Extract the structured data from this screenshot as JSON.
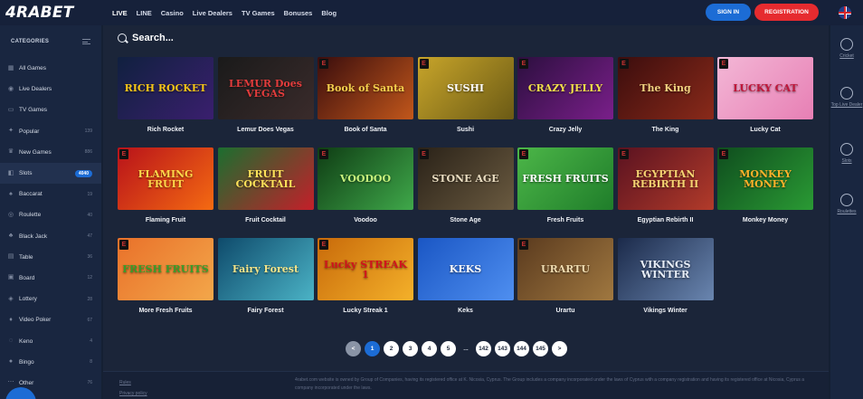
{
  "brand": {
    "logo": "4RABET"
  },
  "nav": [
    "LIVE",
    "LINE",
    "Casino",
    "Live Dealers",
    "TV Games",
    "Bonuses",
    "Blog"
  ],
  "auth": {
    "signin": "SIGN IN",
    "register": "REGISTRATION"
  },
  "colors": {
    "primary": "#1c6cd5",
    "danger": "#e62b2f",
    "bg": "#1b2539",
    "sidebar": "#192640"
  },
  "sidebar": {
    "heading": "CATEGORIES",
    "items": [
      {
        "label": "All Games",
        "count": "",
        "icon": "grid-icon"
      },
      {
        "label": "Live Dealers",
        "count": "",
        "icon": "dealer-icon"
      },
      {
        "label": "TV Games",
        "count": "",
        "icon": "tv-icon"
      },
      {
        "label": "Popular",
        "count": "139",
        "icon": "flame-icon"
      },
      {
        "label": "New Games",
        "count": "886",
        "icon": "crown-icon"
      },
      {
        "label": "Slots",
        "count": "4040",
        "icon": "slot-icon"
      },
      {
        "label": "Baccarat",
        "count": "19",
        "icon": "cards-icon"
      },
      {
        "label": "Roulette",
        "count": "40",
        "icon": "roulette-icon"
      },
      {
        "label": "Black Jack",
        "count": "47",
        "icon": "blackjack-icon"
      },
      {
        "label": "Table",
        "count": "36",
        "icon": "table-icon"
      },
      {
        "label": "Board",
        "count": "12",
        "icon": "board-icon"
      },
      {
        "label": "Lottery",
        "count": "28",
        "icon": "lottery-icon"
      },
      {
        "label": "Video Poker",
        "count": "67",
        "icon": "poker-icon"
      },
      {
        "label": "Keno",
        "count": "4",
        "icon": "keno-icon"
      },
      {
        "label": "Bingo",
        "count": "8",
        "icon": "bingo-icon"
      },
      {
        "label": "Other",
        "count": "76",
        "icon": "other-icon"
      }
    ]
  },
  "search": {
    "label": "Search..."
  },
  "games": [
    {
      "name": "Rich Rocket",
      "art": "RICH ROCKET",
      "bg": "linear-gradient(135deg,#10203f,#3a1f6e)",
      "fg": "#f5c518",
      "e": false
    },
    {
      "name": "Lemur Does Vegas",
      "art": "LEMUR Does VEGAS",
      "bg": "linear-gradient(135deg,#1a1a1a,#3a2b2b)",
      "fg": "#e23c3c",
      "e": false
    },
    {
      "name": "Book of Santa",
      "art": "Book of Santa",
      "bg": "linear-gradient(135deg,#3a0d0d,#c2571b)",
      "fg": "#f6d04d",
      "e": true
    },
    {
      "name": "Sushi",
      "art": "SUSHI",
      "bg": "linear-gradient(135deg,#c8a52a,#6b5a15)",
      "fg": "#ffffff",
      "e": true
    },
    {
      "name": "Crazy Jelly",
      "art": "CRAZY JELLY",
      "bg": "linear-gradient(135deg,#2c0f3f,#7a1f8a)",
      "fg": "#f2e04a",
      "e": true
    },
    {
      "name": "The King",
      "art": "The King",
      "bg": "linear-gradient(135deg,#3b0d0d,#8a2a1a)",
      "fg": "#f2d280",
      "e": true
    },
    {
      "name": "Lucky Cat",
      "art": "LUCKY CAT",
      "bg": "linear-gradient(135deg,#f3b7d6,#e77fb4)",
      "fg": "#c0163a",
      "e": true
    },
    {
      "name": "Flaming Fruit",
      "art": "FLAMING FRUIT",
      "bg": "linear-gradient(135deg,#b8121a,#f46a12)",
      "fg": "#ffd84a",
      "e": true
    },
    {
      "name": "Fruit Cocktail",
      "art": "FRUIT COCKTAIL",
      "bg": "linear-gradient(135deg,#1b6e2f,#c41f2a)",
      "fg": "#ffe25a",
      "e": false
    },
    {
      "name": "Voodoo",
      "art": "VOODOO",
      "bg": "linear-gradient(135deg,#0f3d14,#3fa84a)",
      "fg": "#c8f37d",
      "e": true
    },
    {
      "name": "Stone Age",
      "art": "STONE AGE",
      "bg": "linear-gradient(135deg,#2a2218,#6a5a40)",
      "fg": "#e9dcc0",
      "e": true
    },
    {
      "name": "Fresh Fruits",
      "art": "FRESH FRUITS",
      "bg": "linear-gradient(135deg,#4cb648,#1f7d2a)",
      "fg": "#ffffff",
      "e": true
    },
    {
      "name": "Egyptian Rebirth II",
      "art": "EGYPTIAN REBIRTH II",
      "bg": "linear-gradient(135deg,#5a1220,#b23b2a)",
      "fg": "#f6d472",
      "e": true
    },
    {
      "name": "Monkey Money",
      "art": "MONKEY MONEY",
      "bg": "linear-gradient(135deg,#0f4d1e,#2a9a34)",
      "fg": "#ffb12a",
      "e": true
    },
    {
      "name": "More Fresh Fruits",
      "art": "FRESH FRUITS",
      "bg": "linear-gradient(135deg,#e9712a,#f3a74a)",
      "fg": "#3a9c2a",
      "e": true
    },
    {
      "name": "Fairy Forest",
      "art": "Fairy Forest",
      "bg": "linear-gradient(135deg,#0e4a6b,#4bb3c6)",
      "fg": "#f4e58a",
      "e": false
    },
    {
      "name": "Lucky Streak 1",
      "art": "Lucky STREAK 1",
      "bg": "linear-gradient(135deg,#c86a0a,#f4b12a)",
      "fg": "#d1141d",
      "e": true
    },
    {
      "name": "Keks",
      "art": "KEKS",
      "bg": "linear-gradient(135deg,#1a56c4,#4f8ff0)",
      "fg": "#ffffff",
      "e": false
    },
    {
      "name": "Urartu",
      "art": "URARTU",
      "bg": "linear-gradient(135deg,#5a3a1e,#a07840)",
      "fg": "#f0dcb0",
      "e": true
    },
    {
      "name": "Vikings Winter",
      "art": "VIKINGS WINTER",
      "bg": "linear-gradient(135deg,#1b2a4a,#6a86b0)",
      "fg": "#e8eef8",
      "e": false
    }
  ],
  "pagination": {
    "prev": "<",
    "pages": [
      "1",
      "2",
      "3",
      "4",
      "5"
    ],
    "ellipsis": "...",
    "last_pages": [
      "142",
      "143",
      "144",
      "145"
    ],
    "next": ">",
    "current": "1"
  },
  "footer": {
    "links": [
      "Rules",
      "Privacy policy"
    ],
    "legal": "4rabet.com website is owned by Group of Companies, having its registered office at K. Nicosia, Cyprus. The Group includes a company incorporated under the laws of Cyprus with a company registration and having its registered office at Nicosia, Cyprus a company incorporated under the laws."
  },
  "rightbar": [
    {
      "label": "Cricket",
      "icon": "cricket-icon"
    },
    {
      "label": "Top Live Dealer",
      "icon": "live-dealer-icon"
    },
    {
      "label": "Slots",
      "icon": "dice-icon"
    },
    {
      "label": "Roulettes",
      "icon": "roulette-icon"
    }
  ]
}
